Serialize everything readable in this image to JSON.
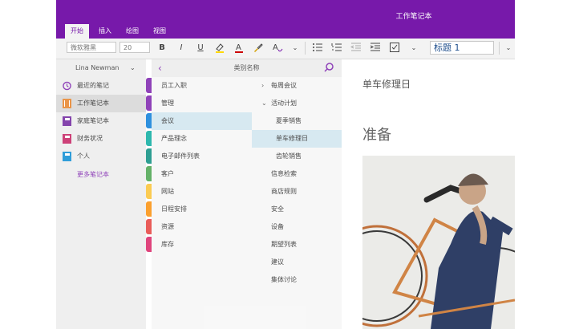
{
  "window": {
    "title": "工作笔记本"
  },
  "tabs": [
    {
      "label": "开始",
      "active": true
    },
    {
      "label": "插入",
      "active": false
    },
    {
      "label": "绘图",
      "active": false
    },
    {
      "label": "视图",
      "active": false
    }
  ],
  "ribbon": {
    "font_name": "微软雅黑",
    "font_size": "20",
    "style": "标题 1",
    "buttons": [
      "bold-icon",
      "italic-icon",
      "underline-icon",
      "highlight-icon",
      "font-color-icon",
      "format-painter-icon",
      "styles-icon",
      "bullets-icon",
      "numbering-icon",
      "outdent-icon",
      "indent-icon",
      "checkbox-icon"
    ]
  },
  "user": {
    "name": "Lina Newman"
  },
  "notebooks": [
    {
      "label": "最近的笔记",
      "icon": "clock-icon",
      "color": "#7719aa",
      "active": false
    },
    {
      "label": "工作笔记本",
      "icon": "notebook-icon",
      "color": "#e67e22",
      "active": true
    },
    {
      "label": "家庭笔记本",
      "icon": "notebook-icon",
      "color": "#6a1b9a",
      "active": false
    },
    {
      "label": "财务状况",
      "icon": "notebook-icon",
      "color": "#c2185b",
      "active": false
    },
    {
      "label": "个人",
      "icon": "notebook-icon",
      "color": "#0288d1",
      "active": false
    }
  ],
  "more_notebooks": "更多笔记本",
  "panel": {
    "header": "类别名称"
  },
  "section_colors": [
    "#7719aa",
    "#7719aa",
    "#0078d7",
    "#00a99d",
    "#00897b",
    "#43a047",
    "#fbc02d",
    "#fb8c00",
    "#e53935",
    "#d81b60"
  ],
  "sections": [
    {
      "label": "员工入职",
      "active": false
    },
    {
      "label": "管理",
      "active": false
    },
    {
      "label": "会议",
      "active": true
    },
    {
      "label": "产品理念",
      "active": false
    },
    {
      "label": "电子邮件列表",
      "active": false
    },
    {
      "label": "客户",
      "active": false
    },
    {
      "label": "网站",
      "active": false
    },
    {
      "label": "日程安排",
      "active": false
    },
    {
      "label": "资源",
      "active": false
    },
    {
      "label": "库存",
      "active": false
    }
  ],
  "pages": [
    {
      "label": "每周会议",
      "chevron": ">",
      "indent": false,
      "active": false
    },
    {
      "label": "活动计划",
      "chevron": "v",
      "indent": false,
      "active": false
    },
    {
      "label": "夏季销售",
      "chevron": "",
      "indent": true,
      "active": false
    },
    {
      "label": "单车修理日",
      "chevron": "",
      "indent": true,
      "active": true
    },
    {
      "label": "齿轮销售",
      "chevron": "",
      "indent": true,
      "active": false
    },
    {
      "label": "信息检索",
      "chevron": "",
      "indent": false,
      "active": false
    },
    {
      "label": "商店规则",
      "chevron": "",
      "indent": false,
      "active": false
    },
    {
      "label": "安全",
      "chevron": "",
      "indent": false,
      "active": false
    },
    {
      "label": "设备",
      "chevron": "",
      "indent": false,
      "active": false
    },
    {
      "label": "期望列表",
      "chevron": "",
      "indent": false,
      "active": false
    },
    {
      "label": "建议",
      "chevron": "",
      "indent": false,
      "active": false
    },
    {
      "label": "集体讨论",
      "chevron": "",
      "indent": false,
      "active": false
    }
  ],
  "canvas": {
    "page_title": "单车修理日",
    "heading": "准备"
  }
}
